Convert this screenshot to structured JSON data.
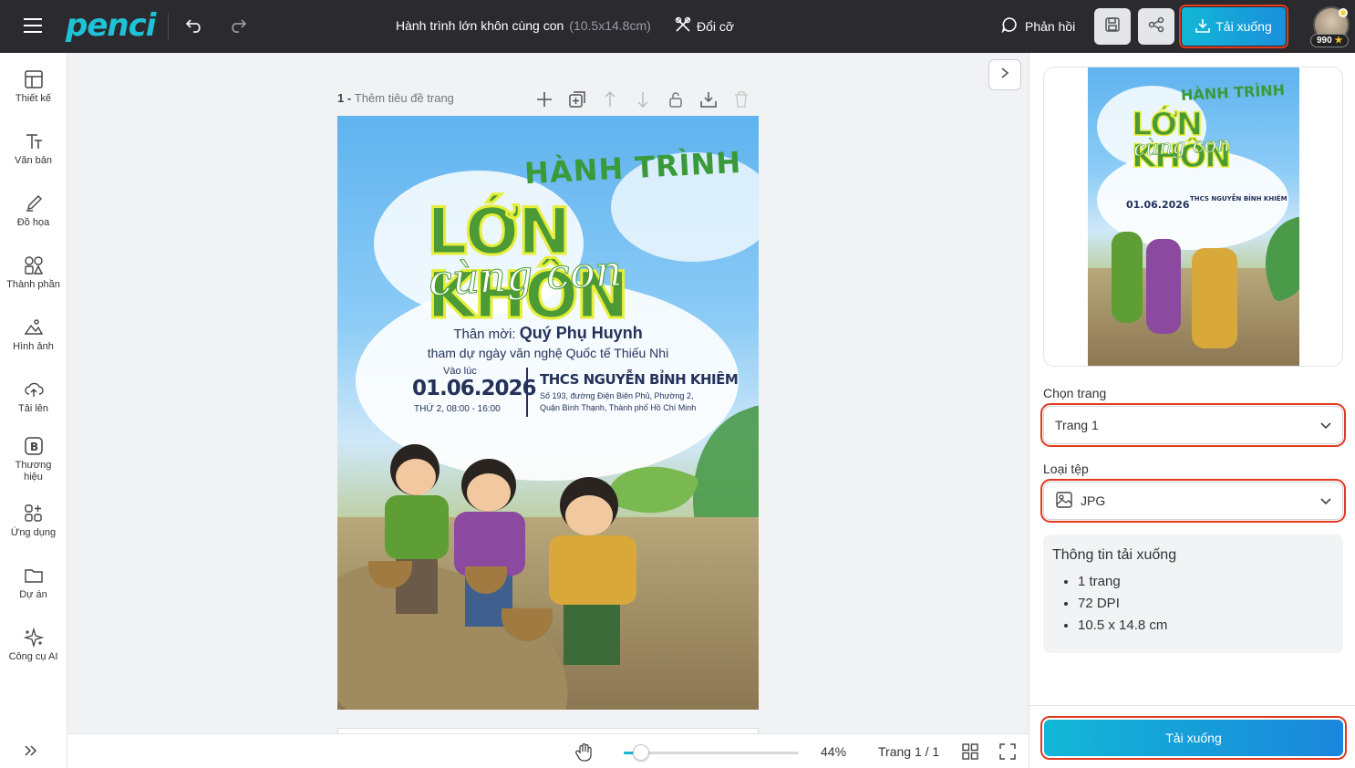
{
  "app": {
    "logo": "penci"
  },
  "header": {
    "doc_title": "Hành trình lớn khôn cùng con",
    "doc_size": "(10.5x14.8cm)",
    "resize_label": "Đổi cỡ",
    "feedback_label": "Phản hồi",
    "download_label": "Tải xuống",
    "credits": "990"
  },
  "sidebar": {
    "items": [
      {
        "label": "Thiết kế",
        "icon": "layout-icon"
      },
      {
        "label": "Văn bản",
        "icon": "text-icon"
      },
      {
        "label": "Đồ họa",
        "icon": "pen-icon"
      },
      {
        "label": "Thành phần",
        "icon": "shapes-icon"
      },
      {
        "label": "Hình ảnh",
        "icon": "image-icon"
      },
      {
        "label": "Tải lên",
        "icon": "upload-cloud-icon"
      },
      {
        "label": "Thương hiệu",
        "icon": "brand-icon"
      },
      {
        "label": "Ứng dụng",
        "icon": "apps-icon"
      },
      {
        "label": "Dự án",
        "icon": "folder-icon"
      },
      {
        "label": "Công cụ AI",
        "icon": "sparkle-icon"
      }
    ]
  },
  "canvas": {
    "page_number": "1 - ",
    "page_title_placeholder": "Thêm tiêu đề trang",
    "poster": {
      "headline_top": "HÀNH TRÌNH",
      "headline_main": "LỚN KHÔN",
      "headline_script": "cùng con",
      "invite_prefix": "Thân mời:",
      "invite_name": "Quý Phụ Huynh",
      "invite_line": "tham dự ngày văn nghệ Quốc tế Thiếu Nhi",
      "time_label": "Vào lúc",
      "date": "01.06.2026",
      "time": "THỨ 2, 08:00 - 16:00",
      "school": "THCS NGUYỄN BỈNH KHIÊM",
      "address1": "Số 193, đường Điện Biên Phủ, Phường 2,",
      "address2": "Quận Bình Thạnh, Thành phố Hồ Chí Minh"
    }
  },
  "bottom": {
    "zoom": "44%",
    "zoom_level": 0.1,
    "page_indicator": "Trang 1 / 1"
  },
  "panel": {
    "page_select_label": "Chọn trang",
    "page_select_value": "Trang 1",
    "file_type_label": "Loại tệp",
    "file_type_value": "JPG",
    "info_title": "Thông tin tải xuống",
    "info_items": [
      "1 trang",
      "72 DPI",
      "10.5 x 14.8 cm"
    ],
    "download_label": "Tải xuống"
  },
  "colors": {
    "accent": "#12b7d6",
    "highlight": "#e03a1e",
    "topbar": "#2b2b2f"
  }
}
